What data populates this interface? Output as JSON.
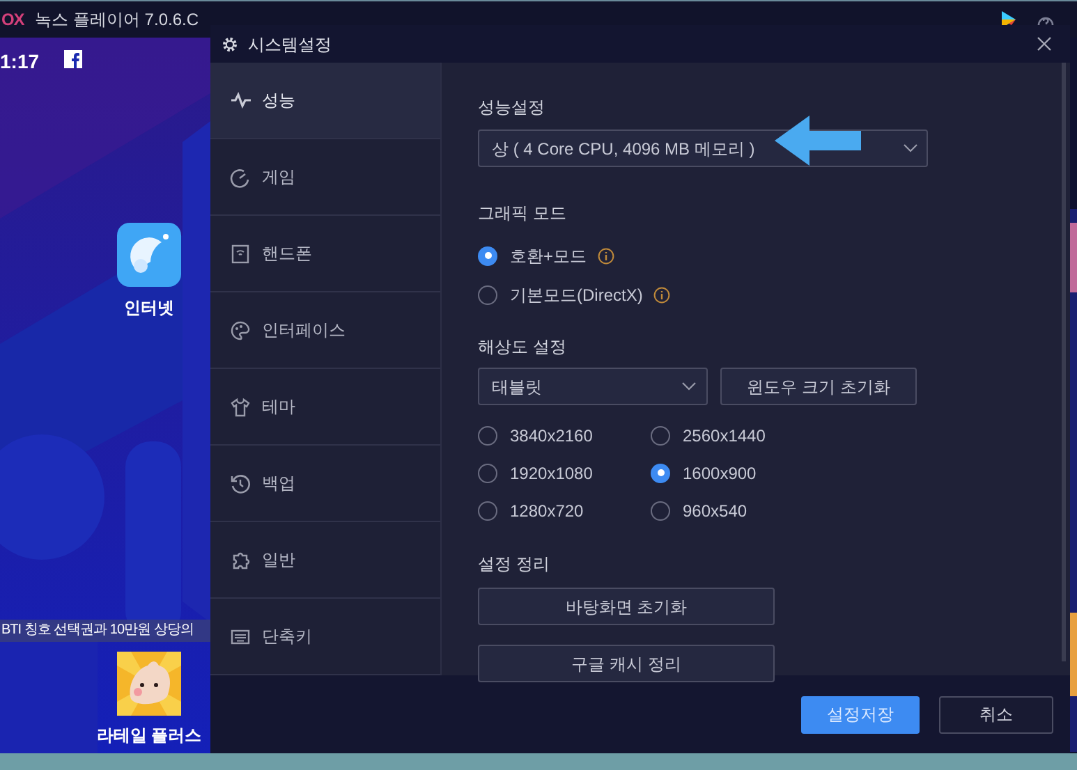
{
  "app_bar": {
    "logo": "OX",
    "title": "녹스 플레이어 7.0.6.C"
  },
  "emulator": {
    "clock": "1:17",
    "apps": [
      {
        "label": "인터넷",
        "kind": "browser"
      },
      {
        "label": "라테일 플러스",
        "kind": "game"
      }
    ],
    "banner": "BTI 칭호 선택권과 10만원 상당의"
  },
  "dialog": {
    "title": "시스템설정",
    "sidebar": {
      "items": [
        {
          "label": "성능",
          "selected": true
        },
        {
          "label": "게임",
          "selected": false
        },
        {
          "label": "핸드폰",
          "selected": false
        },
        {
          "label": "인터페이스",
          "selected": false
        },
        {
          "label": "테마",
          "selected": false
        },
        {
          "label": "백업",
          "selected": false
        },
        {
          "label": "일반",
          "selected": false
        },
        {
          "label": "단축키",
          "selected": false
        }
      ]
    },
    "performance": {
      "heading": "성능설정",
      "value": "상 ( 4 Core CPU, 4096 MB 메모리 )"
    },
    "graphics": {
      "heading": "그래픽 모드",
      "options": [
        {
          "label": "호환+모드",
          "selected": true
        },
        {
          "label": "기본모드(DirectX)",
          "selected": false
        }
      ]
    },
    "resolution": {
      "heading": "해상도 설정",
      "device": "태블릿",
      "reset_button": "윈도우 크기 초기화",
      "options": [
        {
          "label": "3840x2160",
          "selected": false
        },
        {
          "label": "2560x1440",
          "selected": false
        },
        {
          "label": "1920x1080",
          "selected": false
        },
        {
          "label": "1600x900",
          "selected": true
        },
        {
          "label": "1280x720",
          "selected": false
        },
        {
          "label": "960x540",
          "selected": false
        }
      ]
    },
    "cleanup": {
      "heading": "설정 정리",
      "buttons": [
        "바탕화면 초기화",
        "구글 캐시 정리"
      ]
    },
    "footer": {
      "save": "설정저장",
      "cancel": "취소"
    }
  }
}
